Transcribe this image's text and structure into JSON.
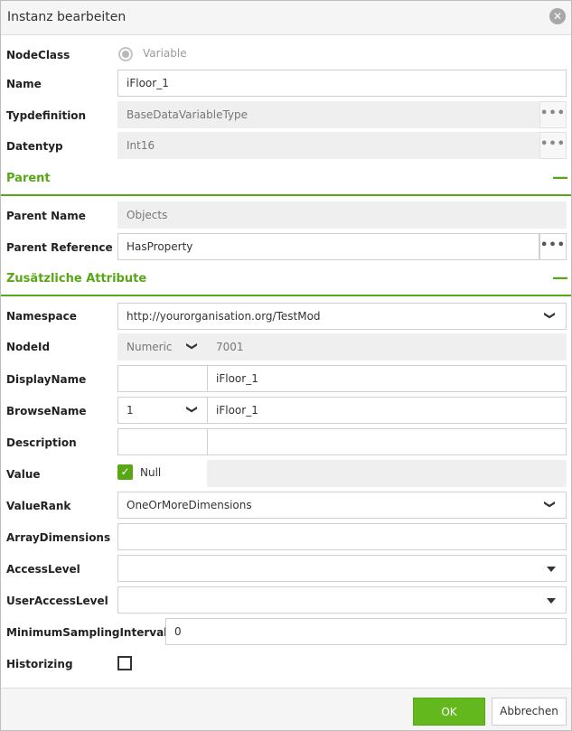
{
  "dialog": {
    "title": "Instanz bearbeiten"
  },
  "colors": {
    "accent": "#57a716",
    "ok_button": "#62b81d"
  },
  "icons": {
    "close": "close-icon",
    "more": "more-icon",
    "chevron": "chevron-down-icon",
    "caret": "caret-down-icon",
    "minus": "minus-icon",
    "check": "check-icon"
  },
  "node": {
    "nodeclass_label": "NodeClass",
    "nodeclass_value": "Variable",
    "name_label": "Name",
    "name_value": "iFloor_1",
    "typedef_label": "Typdefinition",
    "typedef_value": "BaseDataVariableType",
    "datatype_label": "Datentyp",
    "datatype_value": "Int16",
    "more_glyph": "•••"
  },
  "parent": {
    "section_title": "Parent",
    "name_label": "Parent Name",
    "name_value": "Objects",
    "ref_label": "Parent Reference",
    "ref_value": "HasProperty"
  },
  "attributes": {
    "section_title": "Zusätzliche Attribute",
    "namespace_label": "Namespace",
    "namespace_value": "http://yourorganisation.org/TestMod",
    "nodeid_label": "NodeId",
    "nodeid_type": "Numeric",
    "nodeid_value": "7001",
    "displayname_label": "DisplayName",
    "displayname_locale": "",
    "displayname_value": "iFloor_1",
    "browsename_label": "BrowseName",
    "browsename_ns": "1",
    "browsename_value": "iFloor_1",
    "description_label": "Description",
    "description_locale": "",
    "description_value": "",
    "value_label": "Value",
    "value_null_label": "Null",
    "value_null_checked": true,
    "value_value": "",
    "valuerank_label": "ValueRank",
    "valuerank_value": "OneOrMoreDimensions",
    "arraydim_label": "ArrayDimensions",
    "arraydim_value": "",
    "accesslevel_label": "AccessLevel",
    "accesslevel_value": "",
    "useraccesslevel_label": "UserAccessLevel",
    "useraccesslevel_value": "",
    "minsampling_label": "MinimumSamplingInterval",
    "minsampling_value": "0",
    "historizing_label": "Historizing",
    "historizing_checked": false
  },
  "footer": {
    "ok_label": "OK",
    "cancel_label": "Abbrechen"
  }
}
